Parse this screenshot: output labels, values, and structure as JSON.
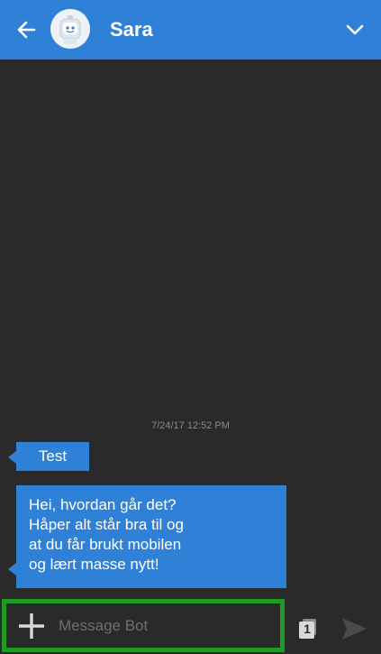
{
  "header": {
    "contact_name": "Sara",
    "back_icon": "arrow-left-icon",
    "menu_icon": "chevron-down-icon",
    "avatar_icon": "robot-avatar-icon",
    "background_color": "#2f81d8"
  },
  "chat": {
    "timestamp": "7/24/17 12:52 PM",
    "messages": [
      {
        "lines": [
          "Test"
        ]
      },
      {
        "lines": [
          "Hei, hvordan går det?",
          "Håper alt står bra til og",
          "at du får brukt mobilen",
          "og lært masse nytt!"
        ]
      }
    ],
    "bubble_color": "#2f81d8",
    "background_color": "#2a2a2a"
  },
  "composer": {
    "placeholder": "Message Bot",
    "value": "",
    "add_icon": "plus-icon",
    "counter_value": "1",
    "send_icon": "send-icon",
    "highlight_color": "#1f9a25"
  }
}
